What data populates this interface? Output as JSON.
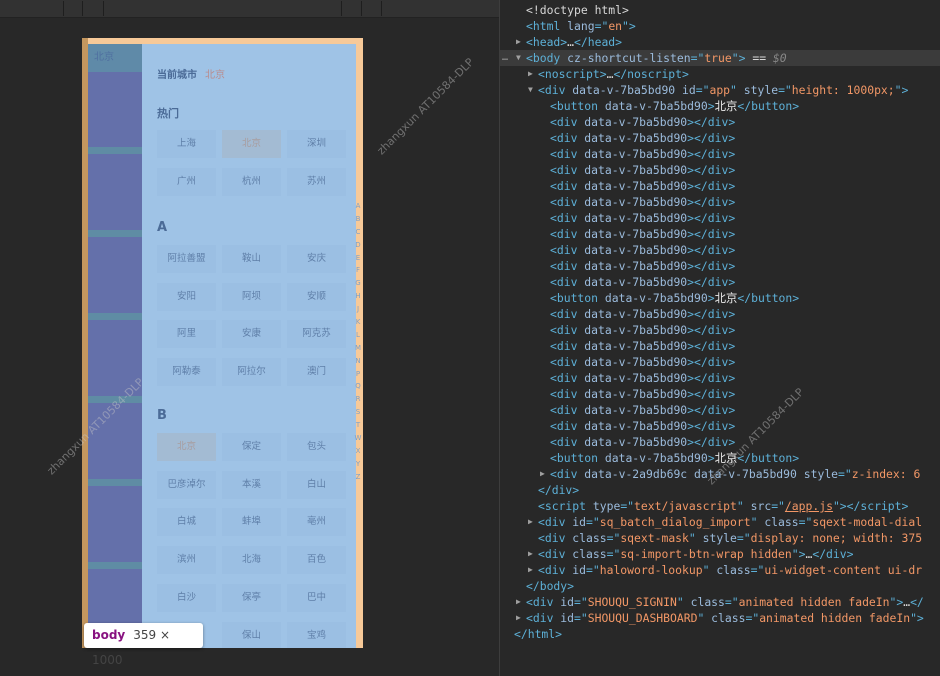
{
  "preview": {
    "top_button": "北京",
    "current_label": "当前城市",
    "current_city": "北京",
    "hot_label": "热门",
    "hot": [
      "上海",
      "北京",
      "深圳",
      "广州",
      "杭州",
      "苏州"
    ],
    "selected_city": "北京",
    "sections": [
      {
        "letter": "A",
        "cities": [
          "阿拉善盟",
          "鞍山",
          "安庆",
          "安阳",
          "阿坝",
          "安顺",
          "阿里",
          "安康",
          "阿克苏",
          "阿勒泰",
          "阿拉尔",
          "澳门"
        ]
      },
      {
        "letter": "B",
        "cities": [
          "北京",
          "保定",
          "包头",
          "巴彦淖尔",
          "本溪",
          "白山",
          "白城",
          "蚌埠",
          "亳州",
          "滨州",
          "北海",
          "百色",
          "白沙",
          "保亭",
          "巴中",
          "",
          "保山",
          "宝鸡"
        ]
      }
    ],
    "index": [
      "A",
      "B",
      "C",
      "D",
      "E",
      "F",
      "G",
      "H",
      "J",
      "K",
      "L",
      "M",
      "N",
      "P",
      "Q",
      "R",
      "S",
      "T",
      "W",
      "X",
      "Y",
      "Z"
    ]
  },
  "tooltip": {
    "tag": "body",
    "size": "359 × 1000"
  },
  "watermark": "zhangxun  AT10584-DLP",
  "devtools": {
    "lines": [
      {
        "d": 0,
        "t": "",
        "p": [
          [
            "plain",
            "<!doctype html>"
          ]
        ]
      },
      {
        "d": 0,
        "t": "",
        "p": [
          [
            "tag",
            "<html"
          ],
          [
            "attr",
            " lang"
          ],
          [
            "tag",
            "=\""
          ],
          [
            "val",
            "en"
          ],
          [
            "tag",
            "\">"
          ]
        ]
      },
      {
        "d": 0,
        "t": "▶",
        "p": [
          [
            "tag",
            "<head>"
          ],
          [
            "plain",
            "…"
          ],
          [
            "tag",
            "</head>"
          ]
        ]
      },
      {
        "d": 0,
        "t": "▼",
        "hl": true,
        "p": [
          [
            "tag",
            "<body"
          ],
          [
            "attr",
            " cz-shortcut-listen"
          ],
          [
            "tag",
            "=\""
          ],
          [
            "val",
            "true"
          ],
          [
            "tag",
            "\">"
          ],
          [
            "plain",
            " == "
          ],
          [
            "dim",
            "$0"
          ]
        ]
      },
      {
        "d": 1,
        "t": "▶",
        "p": [
          [
            "tag",
            "<noscript>"
          ],
          [
            "plain",
            "…"
          ],
          [
            "tag",
            "</noscript>"
          ]
        ]
      },
      {
        "d": 1,
        "t": "▼",
        "p": [
          [
            "tag",
            "<div"
          ],
          [
            "attr",
            " data-v-7ba5bd90 id"
          ],
          [
            "tag",
            "=\""
          ],
          [
            "val",
            "app"
          ],
          [
            "tag",
            "\""
          ],
          [
            "attr",
            " style"
          ],
          [
            "tag",
            "=\""
          ],
          [
            "val",
            "height: 1000px;"
          ],
          [
            "tag",
            "\">"
          ]
        ]
      },
      {
        "d": 2,
        "t": "",
        "p": [
          [
            "tag",
            "<button"
          ],
          [
            "attr",
            " data-v-7ba5bd90"
          ],
          [
            "tag",
            ">"
          ],
          [
            "txt",
            "北京"
          ],
          [
            "tag",
            "</button>"
          ]
        ]
      },
      {
        "d": 2,
        "t": "",
        "p": [
          [
            "tag",
            "<div"
          ],
          [
            "attr",
            " data-v-7ba5bd90"
          ],
          [
            "tag",
            "></div>"
          ]
        ]
      },
      {
        "d": 2,
        "t": "",
        "p": [
          [
            "tag",
            "<div"
          ],
          [
            "attr",
            " data-v-7ba5bd90"
          ],
          [
            "tag",
            "></div>"
          ]
        ]
      },
      {
        "d": 2,
        "t": "",
        "p": [
          [
            "tag",
            "<div"
          ],
          [
            "attr",
            " data-v-7ba5bd90"
          ],
          [
            "tag",
            "></div>"
          ]
        ]
      },
      {
        "d": 2,
        "t": "",
        "p": [
          [
            "tag",
            "<div"
          ],
          [
            "attr",
            " data-v-7ba5bd90"
          ],
          [
            "tag",
            "></div>"
          ]
        ]
      },
      {
        "d": 2,
        "t": "",
        "p": [
          [
            "tag",
            "<div"
          ],
          [
            "attr",
            " data-v-7ba5bd90"
          ],
          [
            "tag",
            "></div>"
          ]
        ]
      },
      {
        "d": 2,
        "t": "",
        "p": [
          [
            "tag",
            "<div"
          ],
          [
            "attr",
            " data-v-7ba5bd90"
          ],
          [
            "tag",
            "></div>"
          ]
        ]
      },
      {
        "d": 2,
        "t": "",
        "p": [
          [
            "tag",
            "<div"
          ],
          [
            "attr",
            " data-v-7ba5bd90"
          ],
          [
            "tag",
            "></div>"
          ]
        ]
      },
      {
        "d": 2,
        "t": "",
        "p": [
          [
            "tag",
            "<div"
          ],
          [
            "attr",
            " data-v-7ba5bd90"
          ],
          [
            "tag",
            "></div>"
          ]
        ]
      },
      {
        "d": 2,
        "t": "",
        "p": [
          [
            "tag",
            "<div"
          ],
          [
            "attr",
            " data-v-7ba5bd90"
          ],
          [
            "tag",
            "></div>"
          ]
        ]
      },
      {
        "d": 2,
        "t": "",
        "p": [
          [
            "tag",
            "<div"
          ],
          [
            "attr",
            " data-v-7ba5bd90"
          ],
          [
            "tag",
            "></div>"
          ]
        ]
      },
      {
        "d": 2,
        "t": "",
        "p": [
          [
            "tag",
            "<div"
          ],
          [
            "attr",
            " data-v-7ba5bd90"
          ],
          [
            "tag",
            "></div>"
          ]
        ]
      },
      {
        "d": 2,
        "t": "",
        "p": [
          [
            "tag",
            "<button"
          ],
          [
            "attr",
            " data-v-7ba5bd90"
          ],
          [
            "tag",
            ">"
          ],
          [
            "txt",
            "北京"
          ],
          [
            "tag",
            "</button>"
          ]
        ]
      },
      {
        "d": 2,
        "t": "",
        "p": [
          [
            "tag",
            "<div"
          ],
          [
            "attr",
            " data-v-7ba5bd90"
          ],
          [
            "tag",
            "></div>"
          ]
        ]
      },
      {
        "d": 2,
        "t": "",
        "p": [
          [
            "tag",
            "<div"
          ],
          [
            "attr",
            " data-v-7ba5bd90"
          ],
          [
            "tag",
            "></div>"
          ]
        ]
      },
      {
        "d": 2,
        "t": "",
        "p": [
          [
            "tag",
            "<div"
          ],
          [
            "attr",
            " data-v-7ba5bd90"
          ],
          [
            "tag",
            "></div>"
          ]
        ]
      },
      {
        "d": 2,
        "t": "",
        "p": [
          [
            "tag",
            "<div"
          ],
          [
            "attr",
            " data-v-7ba5bd90"
          ],
          [
            "tag",
            "></div>"
          ]
        ]
      },
      {
        "d": 2,
        "t": "",
        "p": [
          [
            "tag",
            "<div"
          ],
          [
            "attr",
            " data-v-7ba5bd90"
          ],
          [
            "tag",
            "></div>"
          ]
        ]
      },
      {
        "d": 2,
        "t": "",
        "p": [
          [
            "tag",
            "<div"
          ],
          [
            "attr",
            " data-v-7ba5bd90"
          ],
          [
            "tag",
            "></div>"
          ]
        ]
      },
      {
        "d": 2,
        "t": "",
        "p": [
          [
            "tag",
            "<div"
          ],
          [
            "attr",
            " data-v-7ba5bd90"
          ],
          [
            "tag",
            "></div>"
          ]
        ]
      },
      {
        "d": 2,
        "t": "",
        "p": [
          [
            "tag",
            "<div"
          ],
          [
            "attr",
            " data-v-7ba5bd90"
          ],
          [
            "tag",
            "></div>"
          ]
        ]
      },
      {
        "d": 2,
        "t": "",
        "p": [
          [
            "tag",
            "<div"
          ],
          [
            "attr",
            " data-v-7ba5bd90"
          ],
          [
            "tag",
            "></div>"
          ]
        ]
      },
      {
        "d": 2,
        "t": "",
        "p": [
          [
            "tag",
            "<button"
          ],
          [
            "attr",
            " data-v-7ba5bd90"
          ],
          [
            "tag",
            ">"
          ],
          [
            "txt",
            "北京"
          ],
          [
            "tag",
            "</button>"
          ]
        ]
      },
      {
        "d": 2,
        "t": "▶",
        "p": [
          [
            "tag",
            "<div"
          ],
          [
            "attr",
            " data-v-2a9db69c data-v-7ba5bd90 style"
          ],
          [
            "tag",
            "=\""
          ],
          [
            "val",
            "z-index: 6"
          ]
        ]
      },
      {
        "d": 1,
        "t": "",
        "p": [
          [
            "tag",
            "</div>"
          ]
        ]
      },
      {
        "d": 1,
        "t": "",
        "p": [
          [
            "tag",
            "<script"
          ],
          [
            "attr",
            " type"
          ],
          [
            "tag",
            "=\""
          ],
          [
            "val",
            "text/javascript"
          ],
          [
            "tag",
            "\""
          ],
          [
            "attr",
            " src"
          ],
          [
            "tag",
            "=\""
          ],
          [
            "val u",
            "/app.js"
          ],
          [
            "tag",
            "\"></script>"
          ]
        ]
      },
      {
        "d": 1,
        "t": "▶",
        "p": [
          [
            "tag",
            "<div"
          ],
          [
            "attr",
            " id"
          ],
          [
            "tag",
            "=\""
          ],
          [
            "val",
            "sq_batch_dialog_import"
          ],
          [
            "tag",
            "\""
          ],
          [
            "attr",
            " class"
          ],
          [
            "tag",
            "=\""
          ],
          [
            "val",
            "sqext-modal-dial"
          ]
        ]
      },
      {
        "d": 1,
        "t": "",
        "p": [
          [
            "tag",
            "<div"
          ],
          [
            "attr",
            " class"
          ],
          [
            "tag",
            "=\""
          ],
          [
            "val",
            "sqext-mask"
          ],
          [
            "tag",
            "\""
          ],
          [
            "attr",
            " style"
          ],
          [
            "tag",
            "=\""
          ],
          [
            "val",
            "display: none; width: 375"
          ]
        ]
      },
      {
        "d": 1,
        "t": "▶",
        "p": [
          [
            "tag",
            "<div"
          ],
          [
            "attr",
            " class"
          ],
          [
            "tag",
            "=\""
          ],
          [
            "val",
            "sq-import-btn-wrap hidden"
          ],
          [
            "tag",
            "\">"
          ],
          [
            "plain",
            "…"
          ],
          [
            "tag",
            "</div>"
          ]
        ]
      },
      {
        "d": 1,
        "t": "▶",
        "p": [
          [
            "tag",
            "<div"
          ],
          [
            "attr",
            " id"
          ],
          [
            "tag",
            "=\""
          ],
          [
            "val",
            "haloword-lookup"
          ],
          [
            "tag",
            "\""
          ],
          [
            "attr",
            " class"
          ],
          [
            "tag",
            "=\""
          ],
          [
            "val",
            "ui-widget-content ui-dr"
          ]
        ]
      },
      {
        "d": 0,
        "t": "",
        "p": [
          [
            "tag",
            "</body>"
          ]
        ]
      },
      {
        "d": 0,
        "t": "▶",
        "p": [
          [
            "tag",
            "<div"
          ],
          [
            "attr",
            " id"
          ],
          [
            "tag",
            "=\""
          ],
          [
            "val",
            "SHOUQU_SIGNIN"
          ],
          [
            "tag",
            "\""
          ],
          [
            "attr",
            " class"
          ],
          [
            "tag",
            "=\""
          ],
          [
            "val",
            "animated hidden fadeIn"
          ],
          [
            "tag",
            "\">"
          ],
          [
            "plain",
            "…"
          ],
          [
            "tag",
            "</"
          ]
        ]
      },
      {
        "d": 0,
        "t": "▶",
        "p": [
          [
            "tag",
            "<div"
          ],
          [
            "attr",
            " id"
          ],
          [
            "tag",
            "=\""
          ],
          [
            "val",
            "SHOUQU_DASHBOARD"
          ],
          [
            "tag",
            "\""
          ],
          [
            "attr",
            " class"
          ],
          [
            "tag",
            "=\""
          ],
          [
            "val",
            "animated hidden fadeIn"
          ],
          [
            "tag",
            "\">"
          ]
        ]
      },
      {
        "d": -1,
        "t": "",
        "p": [
          [
            "tag",
            "</html>"
          ]
        ]
      }
    ]
  }
}
